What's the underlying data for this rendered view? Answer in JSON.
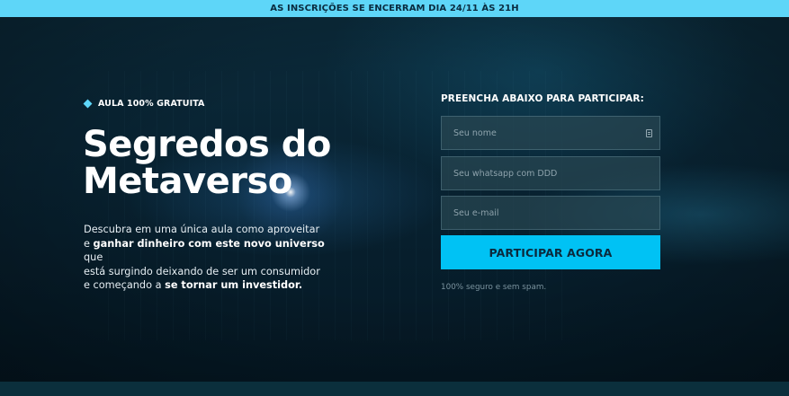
{
  "announcement": {
    "text": "AS INSCRIÇÕES SE ENCERRAM DIA 24/11 ÀS 21H",
    "background": "#5ed6f8"
  },
  "hero": {
    "badge": "AULA 100% GRATUITA",
    "title_line1": "Segredos do",
    "title_line2": "Metaverso",
    "description": {
      "l1": "Descubra em uma única aula como aproveitar",
      "l2_prefix": "e ",
      "l2_bold": "ganhar dinheiro com este novo universo",
      "l2_suffix": " que",
      "l3": "está surgindo deixando de ser um consumidor",
      "l4_prefix": "e começando a ",
      "l4_bold": "se tornar um investidor."
    }
  },
  "form": {
    "title": "PREENCHA ABAIXO PARA PARTICIPAR:",
    "name_placeholder": "Seu nome",
    "phone_placeholder": "Seu whatsapp com DDD",
    "email_placeholder": "Seu e-mail",
    "submit_label": "PARTICIPAR AGORA",
    "secure_note": "100% seguro e sem spam.",
    "accent_color": "#00c2f4"
  }
}
